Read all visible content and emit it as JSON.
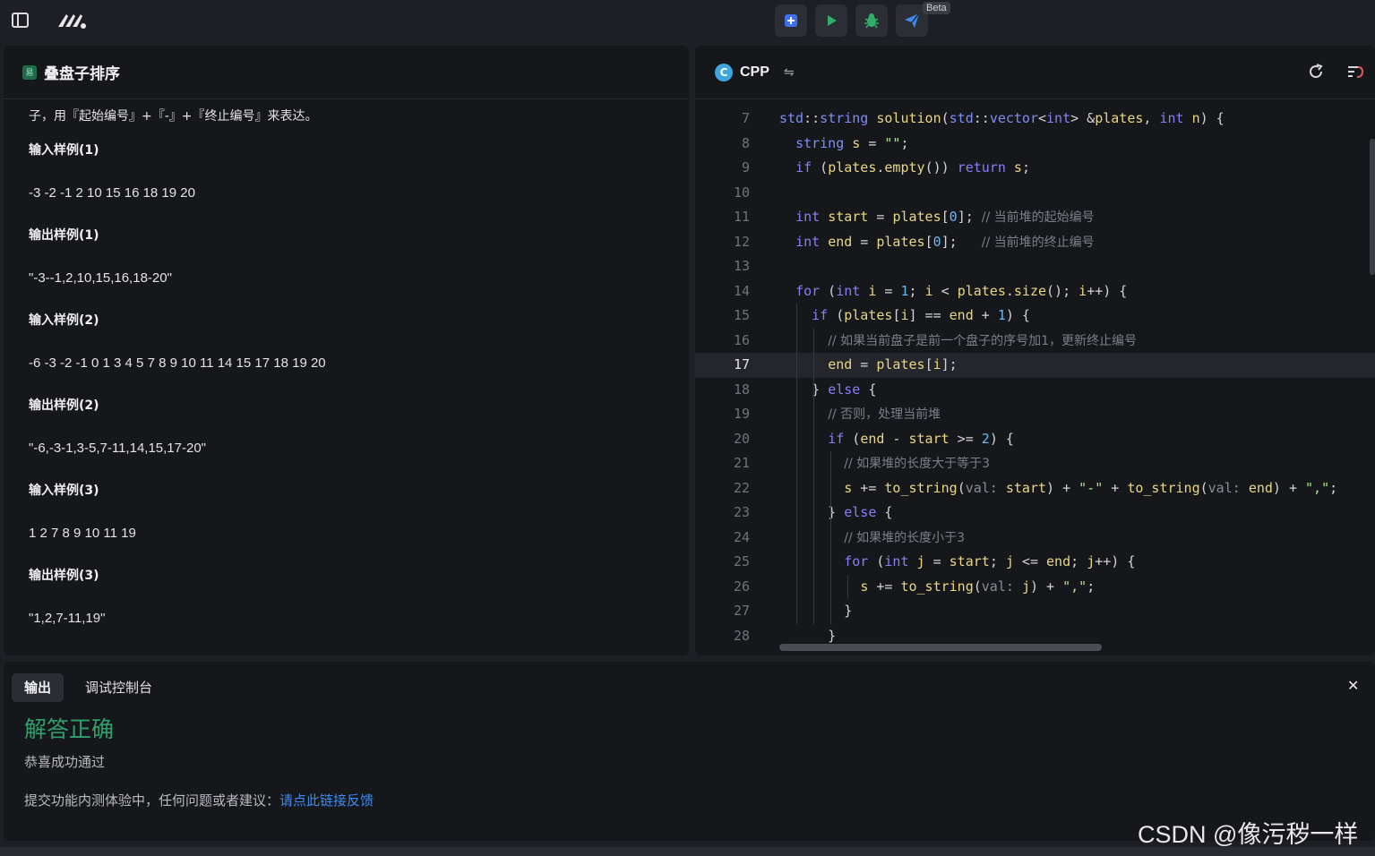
{
  "topbar": {
    "beta_label": "Beta"
  },
  "problem": {
    "difficulty_badge": "易",
    "title": "叠盘子排序",
    "desc_tail": "子，用『起始编号』+『-』+『终止编号』来表达。",
    "samples": [
      {
        "title": "输入样例(1)",
        "value": "-3 -2 -1 2 10 15 16 18 19 20"
      },
      {
        "title": "输出样例(1)",
        "value": "\"-3--1,2,10,15,16,18-20\""
      },
      {
        "title": "输入样例(2)",
        "value": "-6 -3 -2 -1 0 1 3 4 5 7 8 9 10 11 14 15 17 18 19 20"
      },
      {
        "title": "输出样例(2)",
        "value": "\"-6,-3-1,3-5,7-11,14,15,17-20\""
      },
      {
        "title": "输入样例(3)",
        "value": "1 2 7 8 9 10 11 19"
      },
      {
        "title": "输出样例(3)",
        "value": "\"1,2,7-11,19\""
      }
    ]
  },
  "editor": {
    "language": "CPP",
    "lang_icon_letter": "C",
    "current_line": "17",
    "line_numbers": [
      "7",
      "8",
      "9",
      "10",
      "11",
      "12",
      "13",
      "14",
      "15",
      "16",
      "17",
      "18",
      "19",
      "20",
      "21",
      "22",
      "23",
      "24",
      "25",
      "26",
      "27",
      "28"
    ],
    "code_lines": [
      "std::string solution(std::vector<int> &plates, int n) {",
      "  string s = \"\";",
      "  if (plates.empty()) return s;",
      "",
      "  int start = plates[0]; // 当前堆的起始编号",
      "  int end = plates[0];   // 当前堆的终止编号",
      "",
      "  for (int i = 1; i < plates.size(); i++) {",
      "    if (plates[i] == end + 1) {",
      "      // 如果当前盘子是前一个盘子的序号加1，更新终止编号",
      "      end = plates[i];",
      "    } else {",
      "      // 否则，处理当前堆",
      "      if (end - start >= 2) {",
      "        // 如果堆的长度大于等于3",
      "        s += to_string(val: start) + \"-\" + to_string(val: end) + \",\";",
      "      } else {",
      "        // 如果堆的长度小于3",
      "        for (int j = start; j <= end; j++) {",
      "          s += to_string(val: j) + \",\";",
      "        }",
      "      }"
    ]
  },
  "output": {
    "tabs": [
      "输出",
      "调试控制台"
    ],
    "result_title": "解答正确",
    "result_sub": "恭喜成功通过",
    "feedback_text": "提交功能内测体验中，任何问题或者建议：",
    "feedback_link": "请点此链接反馈"
  },
  "watermark": "CSDN @像污秽一样",
  "colors": {
    "success": "#2fa06b",
    "link": "#3d8bf0",
    "accent_blue": "#3f6ef0",
    "run_green": "#2fae6a"
  },
  "icons": [
    "sidebar-toggle-icon",
    "app-logo-icon",
    "submit-icon",
    "run-icon",
    "debug-bug-icon",
    "send-icon",
    "swap-icon",
    "refresh-icon",
    "format-icon",
    "close-icon"
  ]
}
